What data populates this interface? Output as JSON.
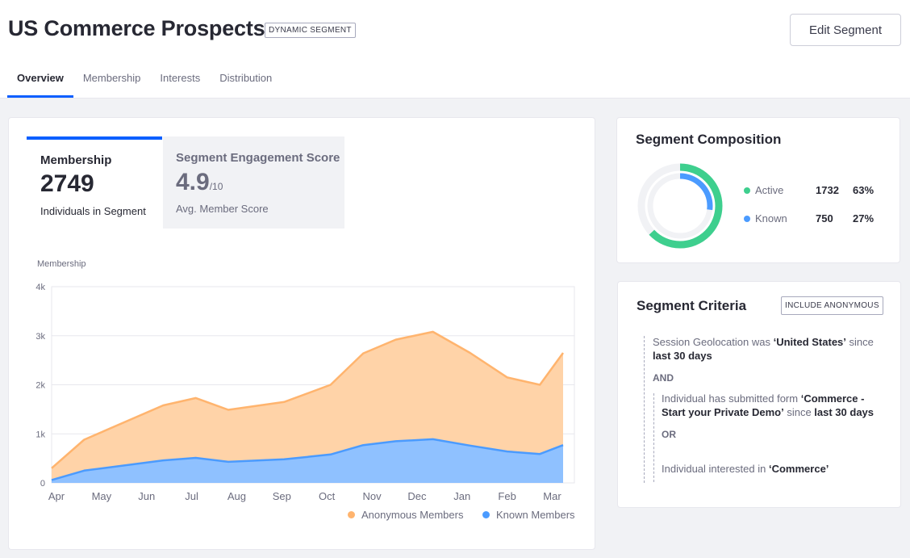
{
  "header": {
    "title": "US Commerce Prospects",
    "badge": "DYNAMIC SEGMENT",
    "edit_label": "Edit Segment"
  },
  "tabs": [
    {
      "label": "Overview",
      "active": true
    },
    {
      "label": "Membership",
      "active": false
    },
    {
      "label": "Interests",
      "active": false
    },
    {
      "label": "Distribution",
      "active": false
    }
  ],
  "metrics": {
    "membership": {
      "label": "Membership",
      "value": "2749",
      "sub": "Individuals in Segment"
    },
    "engagement": {
      "label": "Segment Engagement Score",
      "value": "4.9",
      "denominator": "/10",
      "sub": "Avg. Member Score"
    }
  },
  "chart_title": "Membership",
  "chart_data": {
    "type": "area",
    "ylabel": "Membership",
    "categories": [
      "Apr",
      "May",
      "Jun",
      "Jul",
      "Aug",
      "Sep",
      "Oct",
      "Nov",
      "Dec",
      "Jan",
      "Feb",
      "Mar"
    ],
    "x": [
      0,
      0.3,
      1,
      1.8,
      2.4,
      2.8,
      3.4,
      4.8,
      5.0,
      6.3,
      6.9,
      7.7,
      8.2,
      9.0,
      9.6,
      10.1,
      10.7,
      11.1
    ],
    "y_ticks": [
      "0",
      "1k",
      "2k",
      "3k",
      "4k"
    ],
    "ylim": [
      0,
      4000
    ],
    "series": [
      {
        "name": "Anonymous Members",
        "color": "#ffb46e",
        "fill": "#ffd3a8",
        "values": [
          300,
          880,
          1580,
          1730,
          1490,
          1650,
          2000,
          2640,
          2920,
          3080,
          2650,
          2150,
          2000,
          2650
        ]
      },
      {
        "name": "Known Members",
        "color": "#4b9bff",
        "fill": "#8fc1ff",
        "values": [
          60,
          250,
          460,
          510,
          430,
          480,
          580,
          770,
          850,
          890,
          760,
          640,
          590,
          770
        ]
      }
    ],
    "series_x": [
      0,
      0.7,
      2.4,
      3.1,
      3.8,
      5.0,
      6.0,
      6.7,
      7.4,
      8.2,
      9.0,
      9.8,
      10.5,
      11.0
    ],
    "legend": "bottom-right"
  },
  "composition": {
    "title": "Segment Composition",
    "items": [
      {
        "name": "Active",
        "count": "1732",
        "pct": "63%",
        "fraction": 0.63,
        "color": "#3ecf8e"
      },
      {
        "name": "Known",
        "count": "750",
        "pct": "27%",
        "fraction": 0.27,
        "color": "#4b9bff"
      }
    ]
  },
  "criteria": {
    "title": "Segment Criteria",
    "badge": "INCLUDE ANONYMOUS",
    "c1_pre": "Session Geolocation was ",
    "c1_val": "‘United States’",
    "c1_mid": " since ",
    "c1_time": "last 30 days",
    "and_label": "AND",
    "c2_pre": "Individual has submitted form ",
    "c2_val": "‘Commerce - Start your Private Demo’",
    "c2_mid": "  since ",
    "c2_time": "last 30 days",
    "or_label": "OR",
    "c3_pre": "Individual interested in ",
    "c3_val": "‘Commerce’"
  }
}
